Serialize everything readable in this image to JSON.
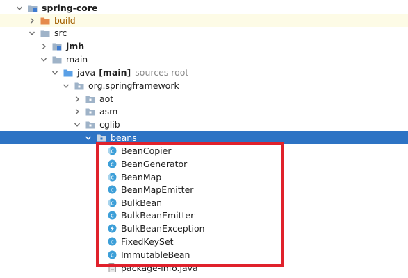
{
  "tree": {
    "root": {
      "label": "spring-core"
    },
    "build": {
      "label": "build"
    },
    "src": {
      "label": "src"
    },
    "jmh": {
      "label": "jmh"
    },
    "main": {
      "label": "main"
    },
    "java": {
      "label": "java",
      "badge": "[main]",
      "hint": "sources root"
    },
    "pkg": {
      "label": "org.springframework"
    },
    "aot": {
      "label": "aot"
    },
    "asm": {
      "label": "asm"
    },
    "cglib": {
      "label": "cglib"
    },
    "beans": {
      "label": "beans"
    },
    "classes": [
      {
        "label": "BeanCopier",
        "kind": "abstract-class-icon"
      },
      {
        "label": "BeanGenerator",
        "kind": "class-icon"
      },
      {
        "label": "BeanMap",
        "kind": "abstract-class-icon"
      },
      {
        "label": "BeanMapEmitter",
        "kind": "class-icon"
      },
      {
        "label": "BulkBean",
        "kind": "abstract-class-icon"
      },
      {
        "label": "BulkBeanEmitter",
        "kind": "class-icon"
      },
      {
        "label": "BulkBeanException",
        "kind": "exception-class-icon"
      },
      {
        "label": "FixedKeySet",
        "kind": "class-icon"
      },
      {
        "label": "ImmutableBean",
        "kind": "class-icon"
      }
    ],
    "package_info": {
      "label": "package-info.java"
    }
  },
  "colors": {
    "selection": "#2d73c4",
    "build_row": "#fdfbe6",
    "highlight_border": "#e0212b",
    "class_icon": "#3d9fd8"
  }
}
